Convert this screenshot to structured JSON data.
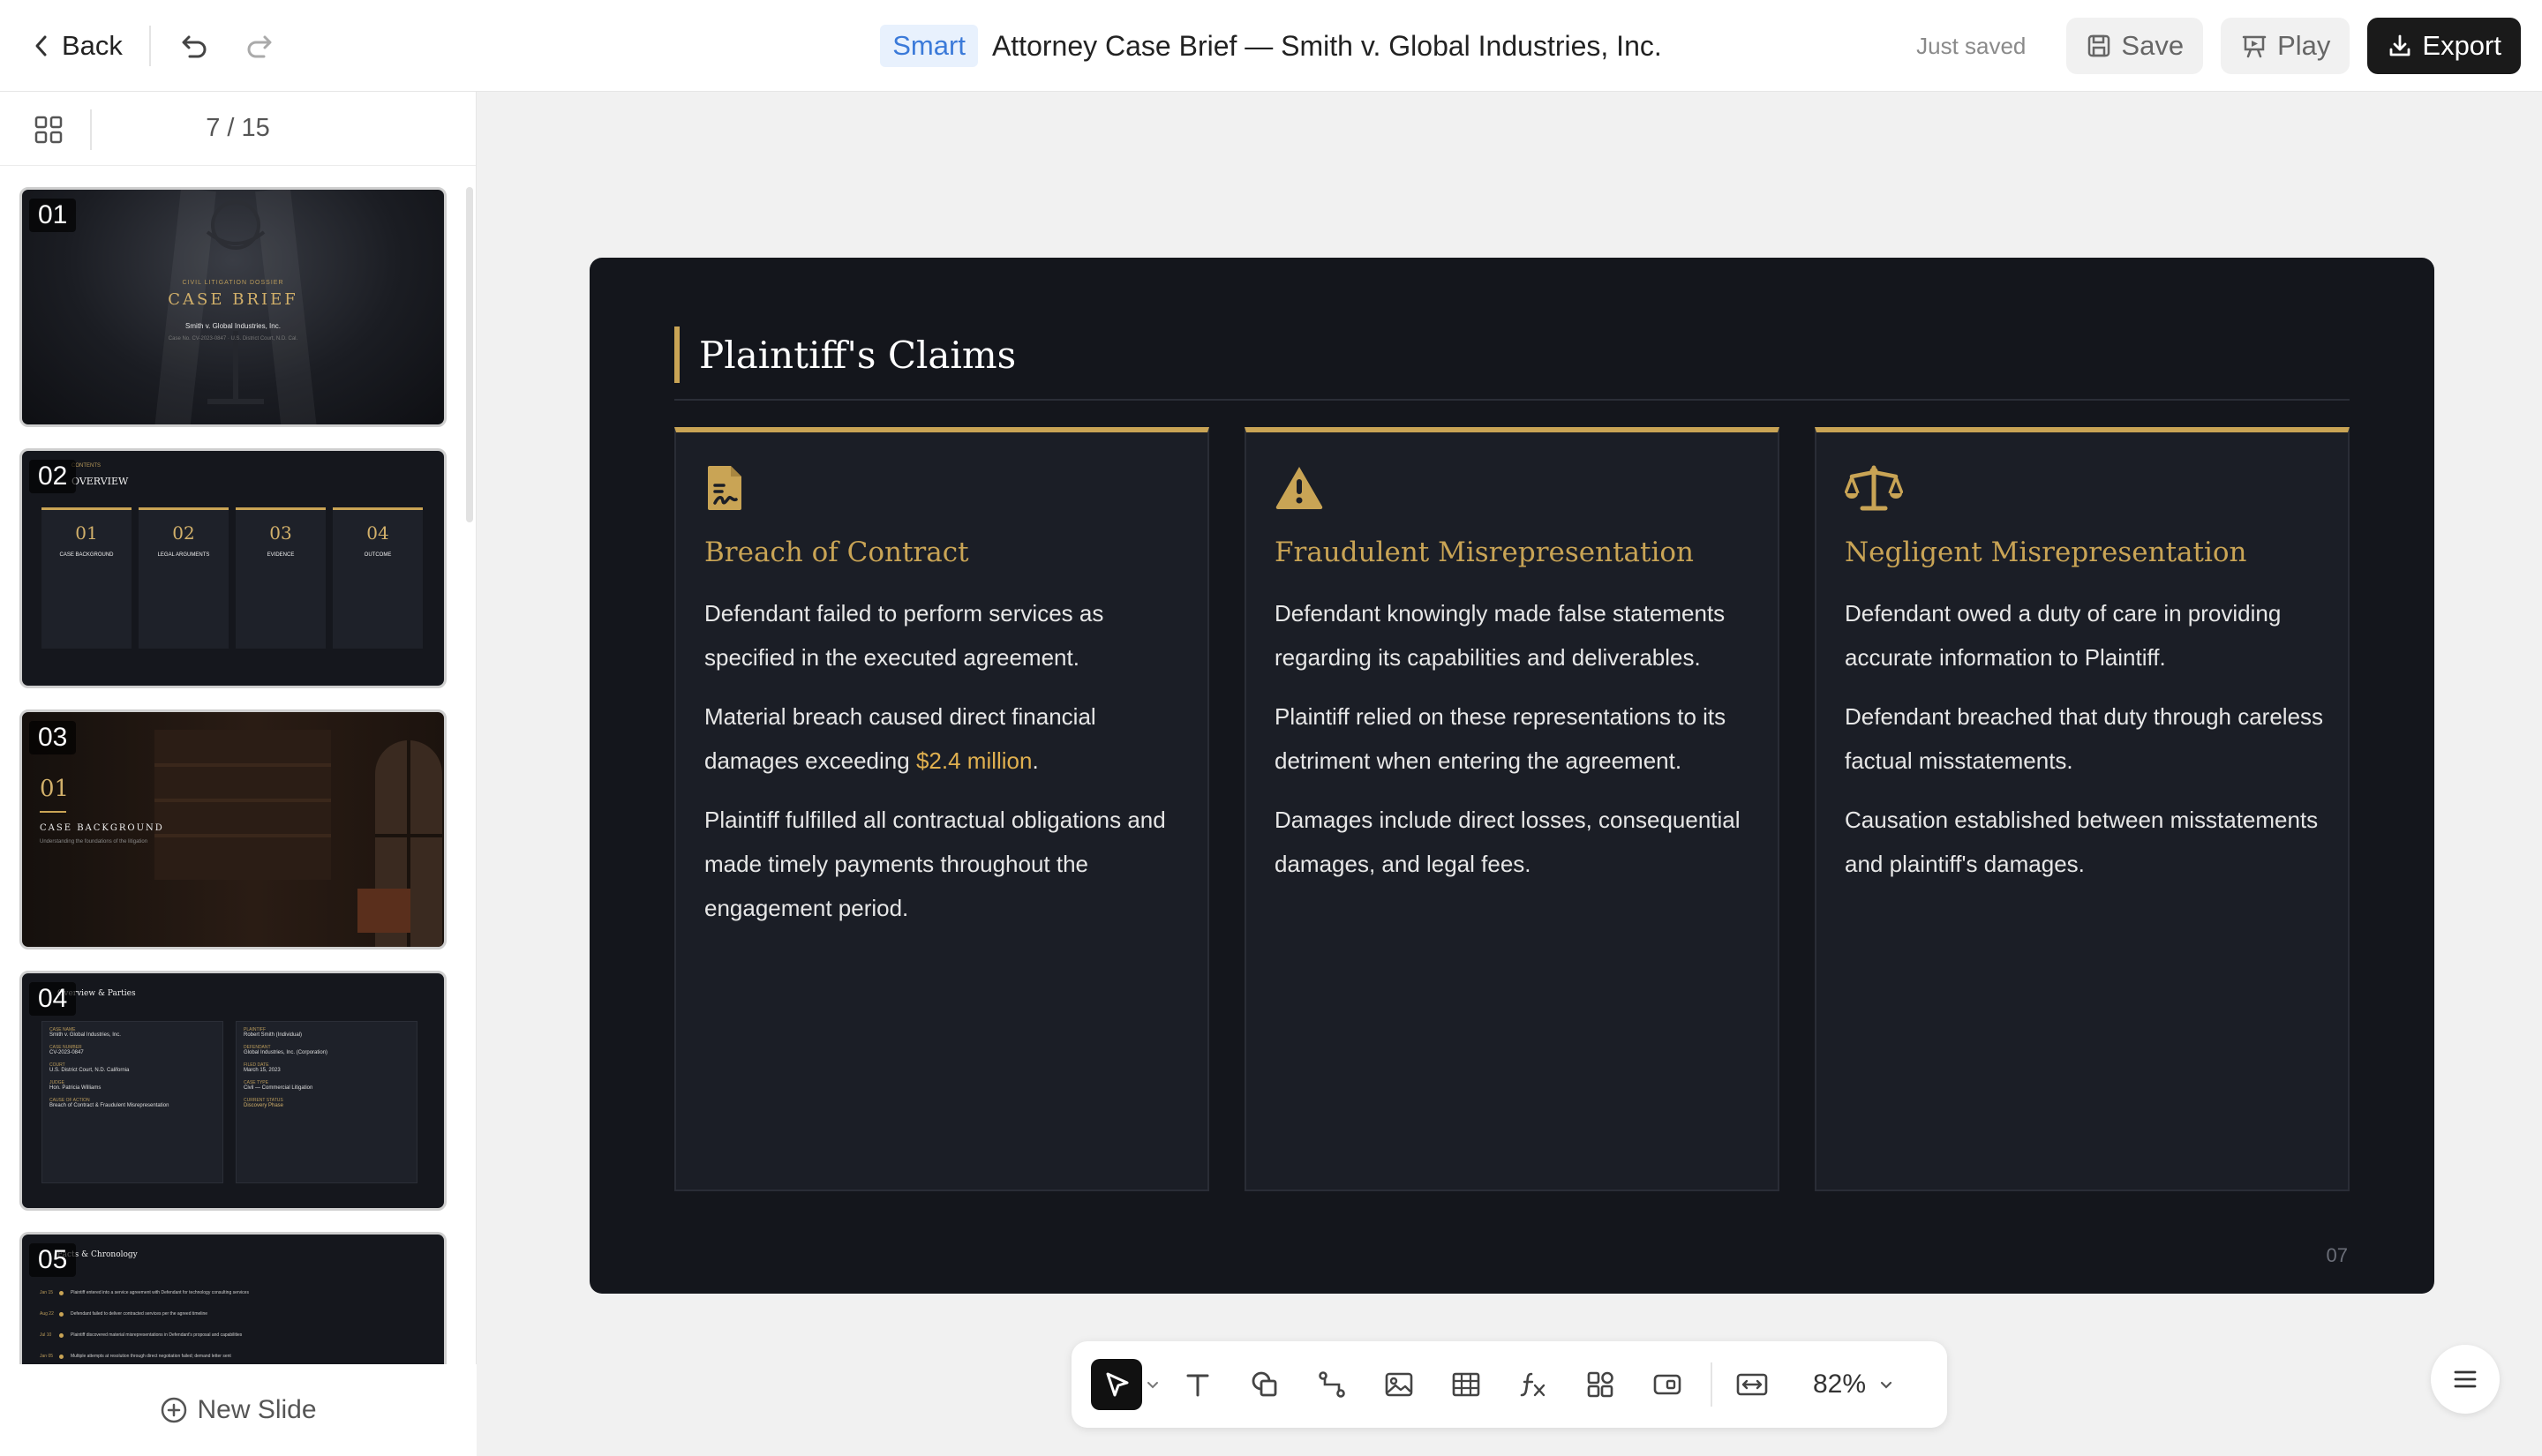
{
  "header": {
    "back_label": "Back",
    "smart_badge": "Smart",
    "title": "Attorney Case Brief — Smith v. Global Industries, Inc.",
    "status": "Just saved",
    "save_label": "Save",
    "play_label": "Play",
    "export_label": "Export"
  },
  "sidebar": {
    "pager": "7 / 15",
    "new_slide_label": "New Slide",
    "thumbs": [
      {
        "num": "01",
        "kicker": "CIVIL LITIGATION DOSSIER",
        "title": "CASE BRIEF",
        "sub": "Smith v. Global Industries, Inc.",
        "meta": "Case No. CV-2023-0847 · U.S. District Court, N.D. Cal."
      },
      {
        "num": "02",
        "heading": "OVERVIEW",
        "kicker": "CONTENTS",
        "cols": [
          {
            "n": "01",
            "label": "CASE BACKGROUND"
          },
          {
            "n": "02",
            "label": "LEGAL ARGUMENTS"
          },
          {
            "n": "03",
            "label": "EVIDENCE"
          },
          {
            "n": "04",
            "label": "OUTCOME"
          }
        ]
      },
      {
        "num": "03",
        "n": "01",
        "title": "CASE BACKGROUND",
        "sub": "Understanding the foundations of the litigation"
      },
      {
        "num": "04",
        "title": "Overview & Parties",
        "left_col": [
          {
            "k": "CASE NAME",
            "v": "Smith v. Global Industries, Inc."
          },
          {
            "k": "CASE NUMBER",
            "v": "CV-2023-0847"
          },
          {
            "k": "COURT",
            "v": "U.S. District Court, N.D. California"
          },
          {
            "k": "JUDGE",
            "v": "Hon. Patricia Williams"
          },
          {
            "k": "CAUSE OF ACTION",
            "v": "Breach of Contract & Fraudulent Misrepresentation"
          }
        ],
        "right_col": [
          {
            "k": "PLAINTIFF",
            "v": "Robert Smith (Individual)"
          },
          {
            "k": "DEFENDANT",
            "v": "Global Industries, Inc. (Corporation)"
          },
          {
            "k": "FILED DATE",
            "v": "March 15, 2023"
          },
          {
            "k": "CASE TYPE",
            "v": "Civil — Commercial Litigation"
          },
          {
            "k": "CURRENT STATUS",
            "v": "Discovery Phase"
          }
        ]
      },
      {
        "num": "05",
        "title": "Facts & Chronology",
        "events": [
          {
            "d": "Jan 15",
            "t": "Plaintiff entered into a service agreement with Defendant for technology consulting services"
          },
          {
            "d": "Aug 22",
            "t": "Defendant failed to deliver contracted services per the agreed timeline"
          },
          {
            "d": "Jul 10",
            "t": "Plaintiff discovered material misrepresentations in Defendant's proposal and capabilities"
          },
          {
            "d": "Jan 05",
            "t": "Multiple attempts at resolution through direct negotiation failed; demand letter sent"
          }
        ]
      }
    ]
  },
  "slide": {
    "title": "Plaintiff's Claims",
    "page_num": "07",
    "cards": [
      {
        "icon": "contract-icon",
        "heading": "Breach of Contract",
        "paras": [
          "Defendant failed to perform services as specified in the executed agreement."
        ],
        "para2_pre": "Material breach caused direct financial damages exceeding ",
        "para2_hl": "$2.4 million",
        "para2_post": ".",
        "para3": "Plaintiff fulfilled all contractual obligations and made timely payments throughout the engagement period."
      },
      {
        "icon": "warning-icon",
        "heading": "Fraudulent Misrepresentation",
        "paras": [
          "Defendant knowingly made false statements regarding its capabilities and deliverables.",
          "Plaintiff relied on these representations to its detriment when entering the agreement.",
          "Damages include direct losses, consequential damages, and legal fees."
        ]
      },
      {
        "icon": "scales-icon",
        "heading": "Negligent Misrepresentation",
        "paras": [
          "Defendant owed a duty of care in providing accurate information to Plaintiff.",
          "Defendant breached that duty through careless factual misstatements.",
          "Causation established between misstatements and plaintiff's damages."
        ]
      }
    ]
  },
  "toolbar": {
    "zoom": "82%",
    "tools": [
      "select-tool",
      "text-tool",
      "shape-tool",
      "connector-tool",
      "image-tool",
      "table-tool",
      "formula-tool",
      "components-tool",
      "media-tool",
      "fit-tool"
    ]
  },
  "colors": {
    "accent_gold": "#c9a455",
    "slide_bg": "#14161c",
    "card_bg": "#1b1e26",
    "highlight": "#e0b04f",
    "smart_blue": "#3b7ad9"
  }
}
